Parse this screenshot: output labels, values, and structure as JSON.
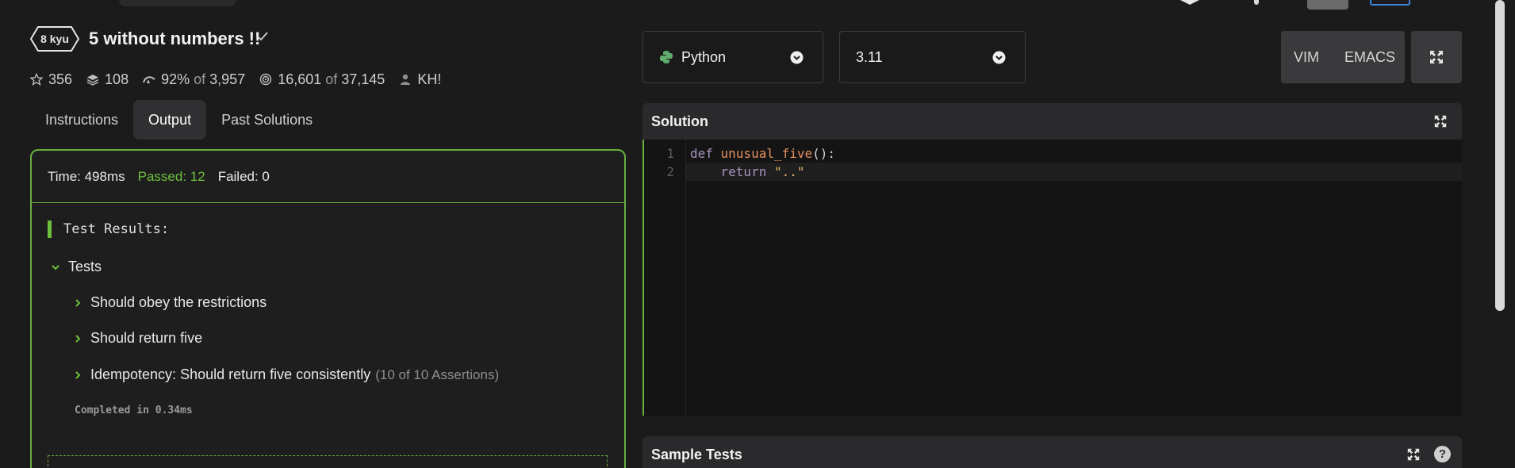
{
  "kata": {
    "rank": "8 kyu",
    "title": "5 without numbers !!",
    "stats": {
      "stars": "356",
      "collections": "108",
      "satisfaction_pct": "92%",
      "of_label": "of",
      "satisfaction_total": "3,957",
      "completed": "16,601",
      "attempted": "37,145",
      "author": "KH!"
    }
  },
  "tabs": [
    {
      "label": "Instructions",
      "active": false
    },
    {
      "label": "Output",
      "active": true
    },
    {
      "label": "Past Solutions",
      "active": false
    }
  ],
  "output": {
    "time": "Time: 498ms",
    "passed": "Passed: 12",
    "failed": "Failed: 0",
    "results_heading": "Test Results:",
    "group": "Tests",
    "items": [
      {
        "label": "Should obey the restrictions",
        "assertions": ""
      },
      {
        "label": "Should return five",
        "assertions": ""
      },
      {
        "label": "Idempotency: Should return five consistently",
        "assertions": "(10 of 10 Assertions)"
      }
    ],
    "completed_in": "Completed in 0.34ms"
  },
  "editor": {
    "language": "Python",
    "version": "3.11",
    "keymaps": [
      "VIM",
      "EMACS"
    ],
    "solution_title": "Solution",
    "sample_tests_title": "Sample Tests",
    "help_label": "?",
    "code": {
      "line_numbers": [
        "1",
        "2"
      ],
      "line1": {
        "kw": "def",
        "fn": "unusual_five",
        "punct": "():"
      },
      "line2": {
        "indent": "    ",
        "kw": "return",
        "str": "\"..\""
      }
    }
  },
  "icons": {
    "rank_badge": "hexagon-badge-icon",
    "check": "check-icon",
    "stars": "star-icon",
    "collections": "layers-icon",
    "satisfaction": "thumbs-icon",
    "completed": "target-icon",
    "author": "user-icon",
    "language": "python-icon",
    "dropdown": "chevron-circle-down-icon",
    "fullscreen": "expand-icon",
    "help": "help-icon"
  },
  "colors": {
    "pass_green": "#6dbf3c",
    "border_green": "#6aae3e",
    "background": "#1b1b1c",
    "panel_header": "#2a2a2c"
  }
}
